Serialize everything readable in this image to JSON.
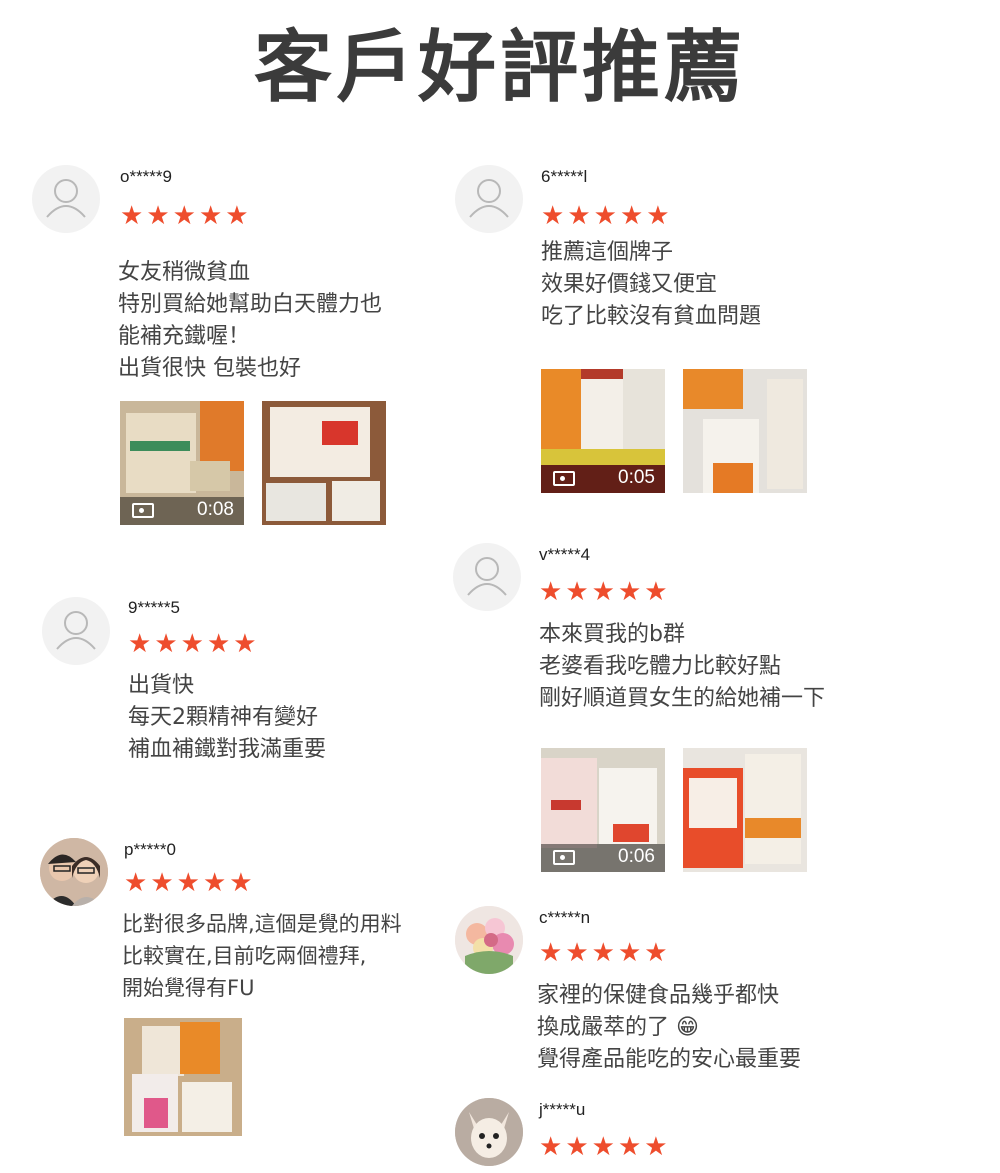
{
  "page": {
    "title": "客戶好評推薦"
  },
  "rating_symbol": "★",
  "colors": {
    "star": "#ee4d2d",
    "text": "#444444",
    "title": "#3b3b3b"
  },
  "reviews": [
    {
      "username": "o*****9",
      "rating": 5,
      "lines": [
        "女友稍微貧血",
        "特別買給她幫助白天體力也",
        "能補充鐵喔！",
        "出貨很快 包裝也好"
      ],
      "media": [
        {
          "type": "video",
          "duration": "0:08"
        },
        {
          "type": "image"
        }
      ]
    },
    {
      "username": "6*****l",
      "rating": 5,
      "lines": [
        "推薦這個牌子",
        "效果好價錢又便宜",
        "吃了比較沒有貧血問題"
      ],
      "media": [
        {
          "type": "video",
          "duration": "0:05"
        },
        {
          "type": "image"
        }
      ]
    },
    {
      "username": "v*****4",
      "rating": 5,
      "lines": [
        "本來買我的b群",
        "老婆看我吃體力比較好點",
        "剛好順道買女生的給她補一下"
      ],
      "media": [
        {
          "type": "video",
          "duration": "0:06"
        },
        {
          "type": "image"
        }
      ]
    },
    {
      "username": "9*****5",
      "rating": 5,
      "lines": [
        "出貨快",
        "每天2顆精神有變好",
        "補血補鐵對我滿重要"
      ],
      "media": []
    },
    {
      "username": "p*****0",
      "rating": 5,
      "lines": [
        "比對很多品牌,這個是覺的用料",
        "比較實在,目前吃兩個禮拜,",
        "開始覺得有FU"
      ],
      "media": [
        {
          "type": "image"
        }
      ]
    },
    {
      "username": "c*****n",
      "rating": 5,
      "lines": [
        "家裡的保健食品幾乎都快",
        "換成嚴萃的了 😁",
        "覺得產品能吃的安心最重要"
      ],
      "media": []
    },
    {
      "username": "j*****u",
      "rating": 5,
      "lines": [],
      "media": []
    }
  ]
}
